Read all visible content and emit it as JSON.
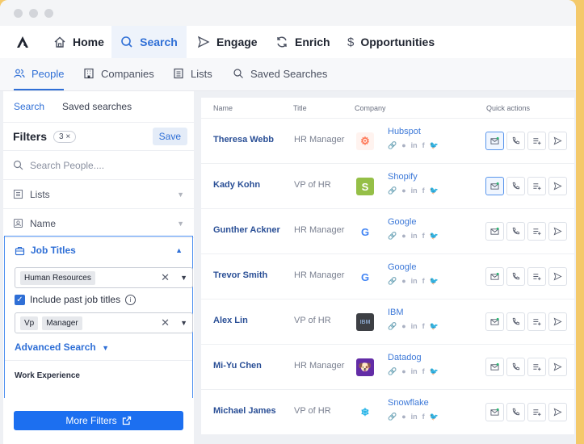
{
  "top_nav": {
    "items": [
      {
        "label": "Home",
        "icon": "home-icon"
      },
      {
        "label": "Search",
        "icon": "search-icon"
      },
      {
        "label": "Engage",
        "icon": "send-icon"
      },
      {
        "label": "Enrich",
        "icon": "refresh-icon"
      },
      {
        "label": "Opportunities",
        "icon": "dollar-icon"
      }
    ],
    "active": "Search"
  },
  "sub_nav": {
    "items": [
      {
        "label": "People",
        "icon": "people-icon"
      },
      {
        "label": "Companies",
        "icon": "building-icon"
      },
      {
        "label": "Lists",
        "icon": "list-icon"
      },
      {
        "label": "Saved Searches",
        "icon": "search-icon"
      }
    ],
    "active": "People"
  },
  "sidebar": {
    "tabs": [
      "Search",
      "Saved searches"
    ],
    "filters_title": "Filters",
    "filter_count": "3 ×",
    "save_label": "Save",
    "search_placeholder": "Search People....",
    "lists_label": "Lists",
    "name_label": "Name",
    "job_titles": {
      "label": "Job Titles",
      "department_tag": "Human Resources",
      "include_past_label": "Include past job titles",
      "include_past_checked": true,
      "seniority_tags": [
        "Vp",
        "Manager"
      ],
      "advanced_search_label": "Advanced Search"
    },
    "work_experience_label": "Work Experience",
    "more_filters_label": "More Filters"
  },
  "table": {
    "columns": [
      "Name",
      "Title",
      "Company",
      "Quick actions"
    ],
    "rows": [
      {
        "name": "Theresa Webb",
        "title": "HR Manager",
        "company": "Hubspot",
        "logo": "hubspot-logo",
        "logo_text": "⚙",
        "logo_color": "#ff7a59",
        "logo_bg": "#fff3ef",
        "email_selected": true
      },
      {
        "name": "Kady Kohn",
        "title": "VP of HR",
        "company": "Shopify",
        "logo": "shopify-logo",
        "logo_text": "S",
        "logo_color": "#ffffff",
        "logo_bg": "#95bf47",
        "email_selected": true
      },
      {
        "name": "Gunther Ackner",
        "title": "HR Manager",
        "company": "Google",
        "logo": "google-logo",
        "logo_text": "G",
        "logo_color": "#4285f4",
        "logo_bg": "#ffffff",
        "email_selected": false
      },
      {
        "name": "Trevor Smith",
        "title": "HR Manager",
        "company": "Google",
        "logo": "google-logo",
        "logo_text": "G",
        "logo_color": "#4285f4",
        "logo_bg": "#ffffff",
        "email_selected": false
      },
      {
        "name": "Alex Lin",
        "title": "VP of HR",
        "company": "IBM",
        "logo": "ibm-logo",
        "logo_text": "IBM",
        "logo_color": "#8aa4c8",
        "logo_bg": "#3d3f44",
        "email_selected": false
      },
      {
        "name": "Mi-Yu Chen",
        "title": "HR Manager",
        "company": "Datadog",
        "logo": "datadog-logo",
        "logo_text": "🐶",
        "logo_color": "#ffffff",
        "logo_bg": "#632ca6",
        "email_selected": false
      },
      {
        "name": "Michael James",
        "title": "VP of HR",
        "company": "Snowflake",
        "logo": "snowflake-logo",
        "logo_text": "❄",
        "logo_color": "#29b5e8",
        "logo_bg": "#ffffff",
        "email_selected": false
      }
    ]
  },
  "colors": {
    "accent": "#2f6fd6",
    "primary_button": "#1c6ff0",
    "background_frame": "#f4c96a"
  }
}
